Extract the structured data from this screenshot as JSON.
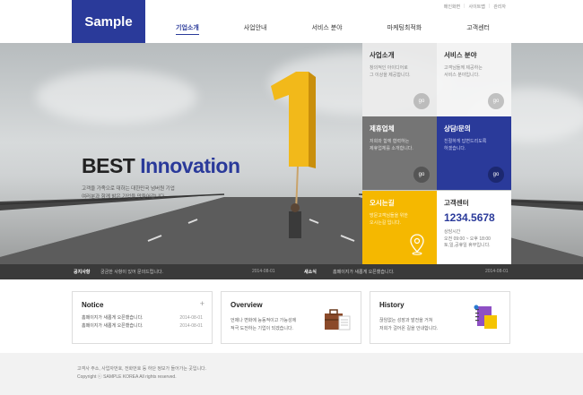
{
  "logo": "Sample",
  "util_links": [
    "메인화면",
    "사이트맵",
    "관리자"
  ],
  "gnb": [
    "기업소개",
    "사업안내",
    "서비스 분야",
    "마케팅최적화",
    "고객센터"
  ],
  "hero": {
    "title_prefix": "BEST",
    "title_highlight": "Innovation",
    "desc_line1": "고객을 가족으로 대하는 대한민국 넘버원 기업",
    "desc_line2": "여러분과 함께 밝은 기업을 만들어갑니다."
  },
  "tiles": {
    "company": {
      "title": "사업소개",
      "desc1": "창의적인 아이디어로",
      "desc2": "그 이상을 제공합니다.",
      "go": "go"
    },
    "service": {
      "title": "서비스 분야",
      "desc1": "고객님들께 제공하는",
      "desc2": "서비스 분야입니다.",
      "go": "go"
    },
    "partner": {
      "title": "제휴업체",
      "desc1": "저희와 함께 협력하는",
      "desc2": "제휴업체를 소개합니다.",
      "go": "go"
    },
    "consult": {
      "title": "상담/문의",
      "desc1": "친절하게 답변드리도록",
      "desc2": "하겠습니다.",
      "go": "go"
    },
    "map": {
      "title": "오시는길",
      "desc1": "방문고객님들을 위한",
      "desc2": "오시는길 입니다."
    },
    "center": {
      "title": "고객센터",
      "phone": "1234.5678",
      "hours_label": "상담시간",
      "hours": "오전 09:00 ~ 오후 18:00",
      "holiday": "토,일,공휴일 휴무입니다."
    }
  },
  "notice_bar": {
    "left_label": "공지사항",
    "left_text": "궁금한 사항이 있어 문의드립니다.",
    "left_date": "2014-08-01",
    "right_label": "새소식",
    "right_text": "홈페이지가 새롭게 오픈했습니다.",
    "right_date": "2014-08-01"
  },
  "notice": {
    "title": "Notice",
    "more": "+",
    "items": [
      {
        "text": "홈페이지가 새롭게 오픈했습니다.",
        "date": "2014-08-01"
      },
      {
        "text": "홈페이지가 새롭게 오픈했습니다.",
        "date": "2014-08-01"
      }
    ]
  },
  "overview": {
    "title": "Overview",
    "desc1": "언제나 변화에 능동적이고 가능성에",
    "desc2": "적극 도전하는 기업이 되겠습니다."
  },
  "history": {
    "title": "History",
    "desc1": "끊임없는 성장과 발전을 거쳐",
    "desc2": "저희가 걸어온 길을 안내합니다."
  },
  "footer": {
    "line1": "고객사 주소, 사업자번호, 전화번호 등 하단 정보가 들어가는 곳입니다.",
    "line2": "Copyright ⓒ SAMPLE KOREA All rights reserved."
  },
  "colors": {
    "brand": "#2a3a9a",
    "accent": "#f5b800",
    "tile_gray": "#757575",
    "tile_light": "#e9e9e9"
  }
}
